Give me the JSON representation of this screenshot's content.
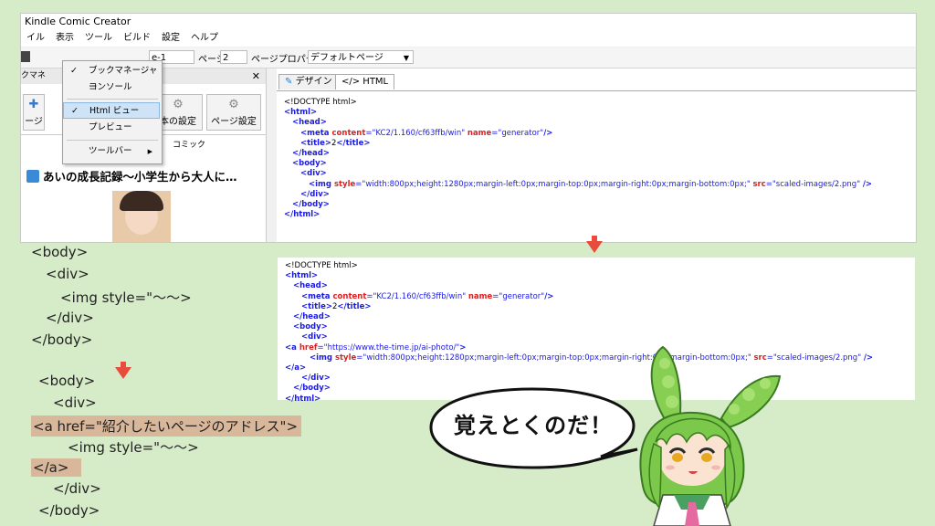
{
  "app": {
    "title": "Kindle Comic Creator",
    "menu": [
      "イル",
      "表示",
      "ツール",
      "ビルド",
      "設定",
      "ヘルプ"
    ],
    "toolbar": {
      "page_field_value": "e-1",
      "page_label": "ページ",
      "page_number": "2",
      "page_props_label": "ページプロパティ",
      "default_page_select": "デフォルトページ"
    },
    "left_panel": {
      "header": "クマネ",
      "buttons": [
        {
          "label": "ージ"
        },
        {
          "label": "本の設定"
        },
        {
          "label": "ページ設定"
        }
      ],
      "comic_label": "コミック",
      "book_title": "あいの成長記録〜小学生から大人に…"
    },
    "dropdown": {
      "items": [
        {
          "label": "ブックマネージャー",
          "checked": true
        },
        {
          "label": "コンソール",
          "checked": false
        },
        {
          "label": "Html ビュー",
          "checked": true,
          "selected": true
        },
        {
          "label": "プレビュー",
          "checked": false
        },
        {
          "label": "ツールバー",
          "checked": false,
          "submenu": true
        }
      ]
    },
    "tabs": [
      "デザイン",
      "</> HTML"
    ],
    "code_lines": [
      {
        "indent": 0,
        "parts": [
          [
            "txt",
            "<!DOCTYPE html>"
          ]
        ]
      },
      {
        "indent": 0,
        "parts": [
          [
            "tag",
            "<html>"
          ]
        ]
      },
      {
        "indent": 1,
        "parts": [
          [
            "tag",
            "<head>"
          ]
        ]
      },
      {
        "indent": 2,
        "parts": [
          [
            "tag",
            "<meta "
          ],
          [
            "attr",
            "content"
          ],
          [
            "val",
            "=\"KC2/1.160/cf63ffb/win\" "
          ],
          [
            "attr",
            "name"
          ],
          [
            "val",
            "=\"generator\""
          ],
          [
            "tag",
            "/>"
          ]
        ]
      },
      {
        "indent": 2,
        "parts": [
          [
            "tag",
            "<title>"
          ],
          [
            "txt",
            "2"
          ],
          [
            "tag",
            "</title>"
          ]
        ]
      },
      {
        "indent": 1,
        "parts": [
          [
            "tag",
            "</head>"
          ]
        ]
      },
      {
        "indent": 1,
        "parts": [
          [
            "tag",
            "<body>"
          ]
        ]
      },
      {
        "indent": 2,
        "parts": [
          [
            "tag",
            "<div>"
          ]
        ]
      },
      {
        "indent": 3,
        "parts": [
          [
            "tag",
            "<img "
          ],
          [
            "attr",
            "style"
          ],
          [
            "val",
            "=\"width:800px;height:1280px;margin-left:0px;margin-top:0px;margin-right:0px;margin-bottom:0px;\" "
          ],
          [
            "attr",
            "src"
          ],
          [
            "val",
            "=\"scaled-images/2.png\" "
          ],
          [
            "tag",
            "/>"
          ]
        ]
      },
      {
        "indent": 2,
        "parts": [
          [
            "tag",
            "</div>"
          ]
        ]
      },
      {
        "indent": 1,
        "parts": [
          [
            "tag",
            "</body>"
          ]
        ]
      },
      {
        "indent": 0,
        "parts": [
          [
            "tag",
            "</html>"
          ]
        ]
      }
    ]
  },
  "code2_lines": [
    {
      "indent": 0,
      "parts": [
        [
          "txt",
          "<!DOCTYPE html>"
        ]
      ]
    },
    {
      "indent": 0,
      "parts": [
        [
          "tag",
          "<html>"
        ]
      ]
    },
    {
      "indent": 1,
      "parts": [
        [
          "tag",
          "<head>"
        ]
      ]
    },
    {
      "indent": 2,
      "parts": [
        [
          "tag",
          "<meta "
        ],
        [
          "attr",
          "content"
        ],
        [
          "val",
          "=\"KC2/1.160/cf63ffb/win\" "
        ],
        [
          "attr",
          "name"
        ],
        [
          "val",
          "=\"generator\""
        ],
        [
          "tag",
          "/>"
        ]
      ]
    },
    {
      "indent": 2,
      "parts": [
        [
          "tag",
          "<title>"
        ],
        [
          "txt",
          "2"
        ],
        [
          "tag",
          "</title>"
        ]
      ]
    },
    {
      "indent": 1,
      "parts": [
        [
          "tag",
          "</head>"
        ]
      ]
    },
    {
      "indent": 1,
      "parts": [
        [
          "tag",
          "<body>"
        ]
      ]
    },
    {
      "indent": 2,
      "parts": [
        [
          "tag",
          "<div>"
        ]
      ]
    },
    {
      "indent": 0,
      "parts": [
        [
          "tag",
          "<a "
        ],
        [
          "attr",
          "href"
        ],
        [
          "val",
          "=\"https://www.the-time.jp/ai-photo/\""
        ],
        [
          "tag",
          ">"
        ]
      ]
    },
    {
      "indent": 3,
      "parts": [
        [
          "tag",
          "<img "
        ],
        [
          "attr",
          "style"
        ],
        [
          "val",
          "=\"width:800px;height:1280px;margin-left:0px;margin-top:0px;margin-right:0px;margin-bottom:0px;\" "
        ],
        [
          "attr",
          "src"
        ],
        [
          "val",
          "=\"scaled-images/2.png\" "
        ],
        [
          "tag",
          "/>"
        ]
      ]
    },
    {
      "indent": 0,
      "parts": [
        [
          "tag",
          "</a>"
        ]
      ]
    },
    {
      "indent": 2,
      "parts": [
        [
          "tag",
          "</div>"
        ]
      ]
    },
    {
      "indent": 1,
      "parts": [
        [
          "tag",
          "</body>"
        ]
      ]
    },
    {
      "indent": 0,
      "parts": [
        [
          "tag",
          "</html>"
        ]
      ]
    }
  ],
  "left_code_top": [
    "<body>",
    "<div>",
    "<img style=\"〜〜>",
    "</div>",
    "</body>"
  ],
  "left_code_bottom": {
    "line1": "<body>",
    "line2": "<div>",
    "line3": "<a href=\"紹介したいページのアドレス\">",
    "line4": "<img style=\"〜〜>",
    "line5": "</a>",
    "line6": "</div>",
    "line7": "</body>"
  },
  "bubble": {
    "text": "覚えとくのだ！"
  },
  "colors": {
    "background": "#d6ecc8",
    "arrow": "#e74c3c",
    "highlight": "#d8b79a",
    "tag_blue": "#1a1ae6",
    "attr_red": "#e02020",
    "character_green": "#7cc84a"
  }
}
